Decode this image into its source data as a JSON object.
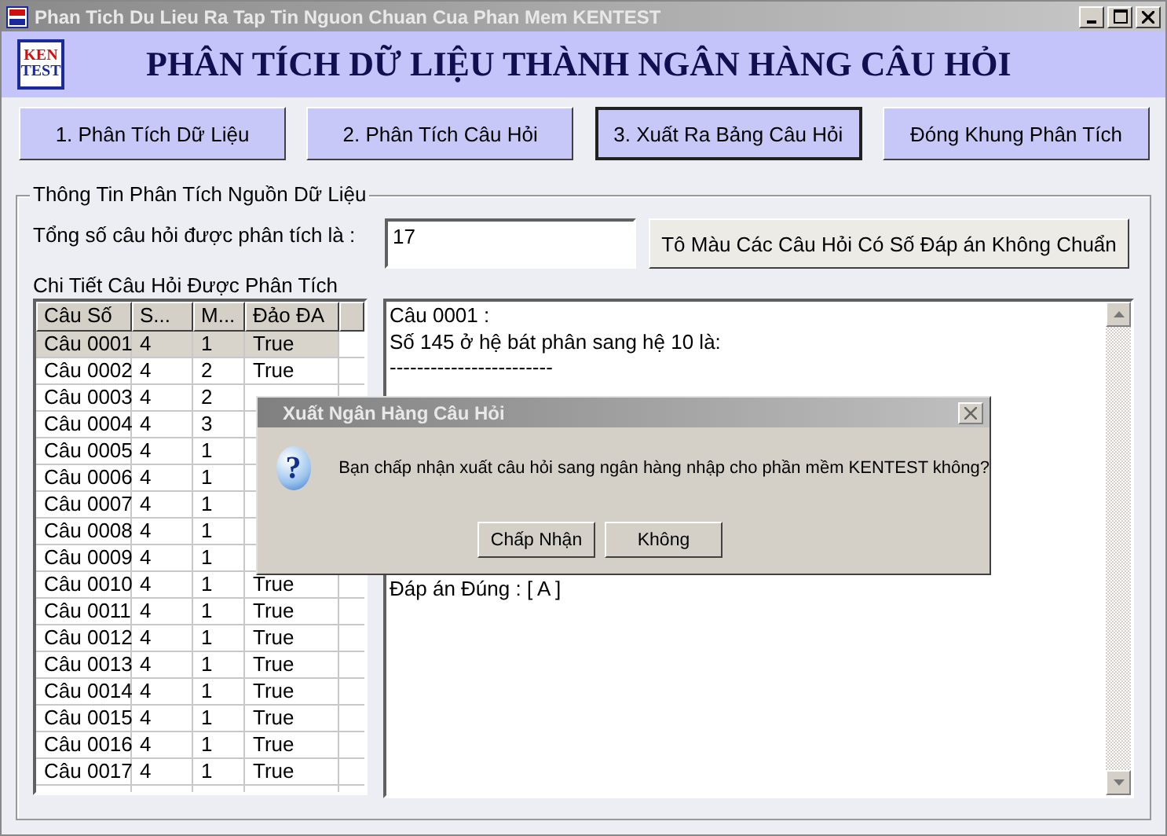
{
  "window": {
    "title": "Phan Tich Du Lieu Ra Tap Tin Nguon Chuan Cua Phan Mem KENTEST"
  },
  "header": {
    "logo_top": "KEN",
    "logo_bottom": "TEST",
    "title": "PHÂN TÍCH DỮ LIỆU THÀNH NGÂN HÀNG CÂU HỎI"
  },
  "nav_buttons": [
    {
      "label": "1. Phân Tích Dữ Liệu",
      "selected": false
    },
    {
      "label": "2. Phân Tích Câu Hỏi",
      "selected": false
    },
    {
      "label": "3. Xuất Ra Bảng Câu Hỏi",
      "selected": true
    },
    {
      "label": "Đóng Khung Phân Tích",
      "selected": false
    }
  ],
  "group": {
    "title": "Thông Tin Phân Tích Nguồn Dữ Liệu",
    "total_label": "Tổng số câu hỏi được phân tích là :",
    "total_value": "17",
    "color_button": "Tô Màu Các Câu Hỏi Có Số Đáp án Không Chuẩn",
    "detail_label": "Chi Tiết Câu Hỏi Được Phân Tích"
  },
  "table": {
    "columns": [
      "Câu Số",
      "S...",
      "M...",
      "Đảo ĐA"
    ],
    "rows": [
      {
        "cells": [
          "Câu 0001",
          "4",
          "1",
          "True"
        ],
        "selected": true
      },
      {
        "cells": [
          "Câu 0002",
          "4",
          "2",
          "True"
        ],
        "selected": false
      },
      {
        "cells": [
          "Câu 0003",
          "4",
          "2"
        ],
        "selected": false
      },
      {
        "cells": [
          "Câu 0004",
          "4",
          "3"
        ],
        "selected": false
      },
      {
        "cells": [
          "Câu 0005",
          "4",
          "1"
        ],
        "selected": false
      },
      {
        "cells": [
          "Câu 0006",
          "4",
          "1"
        ],
        "selected": false
      },
      {
        "cells": [
          "Câu 0007",
          "4",
          "1"
        ],
        "selected": false
      },
      {
        "cells": [
          "Câu 0008",
          "4",
          "1"
        ],
        "selected": false
      },
      {
        "cells": [
          "Câu 0009",
          "4",
          "1"
        ],
        "selected": false
      },
      {
        "cells": [
          "Câu 0010",
          "4",
          "1",
          "True"
        ],
        "selected": false
      },
      {
        "cells": [
          "Câu 0011",
          "4",
          "1",
          "True"
        ],
        "selected": false
      },
      {
        "cells": [
          "Câu 0012",
          "4",
          "1",
          "True"
        ],
        "selected": false
      },
      {
        "cells": [
          "Câu 0013",
          "4",
          "1",
          "True"
        ],
        "selected": false
      },
      {
        "cells": [
          "Câu 0014",
          "4",
          "1",
          "True"
        ],
        "selected": false
      },
      {
        "cells": [
          "Câu 0015",
          "4",
          "1",
          "True"
        ],
        "selected": false
      },
      {
        "cells": [
          "Câu 0016",
          "4",
          "1",
          "True"
        ],
        "selected": false
      },
      {
        "cells": [
          "Câu 0017",
          "4",
          "1",
          "True"
        ],
        "selected": false
      }
    ]
  },
  "detail_text": {
    "lines_above": [
      "Câu 0001 :",
      "Số 145 ở hệ bát phân sang hệ 10 là:",
      "------------------------"
    ],
    "lines_below": [
      "Đáp án Đúng : [ A ]"
    ]
  },
  "dialog": {
    "title": "Xuất Ngân Hàng Câu Hỏi",
    "icon_glyph": "?",
    "message": "Bạn chấp nhận xuất câu hỏi sang ngân hàng nhập cho phần mềm KENTEST không?",
    "buttons": [
      "Chấp Nhận",
      "Không"
    ]
  }
}
